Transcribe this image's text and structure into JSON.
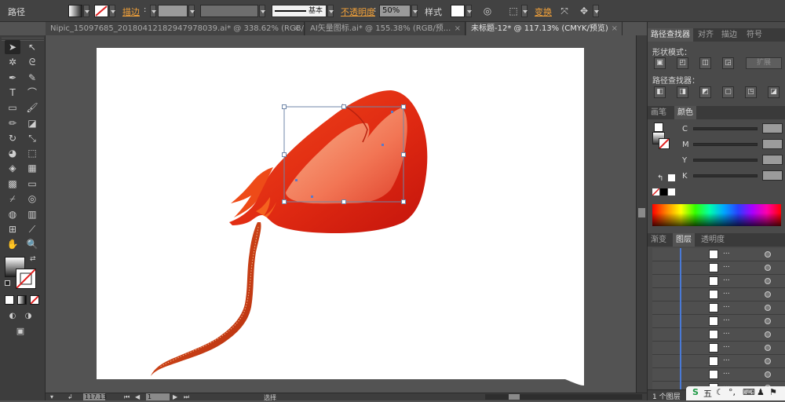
{
  "control_bar": {
    "path_label": "路径",
    "stroke_label": "描边",
    "stroke_profile": "基本",
    "opacity_label": "不透明度",
    "opacity_value": "50%",
    "style_label": "样式",
    "transform_label": "变换"
  },
  "tabs": [
    {
      "label": "Nipic_15097685_20180412182947978039.ai* @ 338.62% (RGB/预...",
      "close": "×"
    },
    {
      "label": "AI矢量图标.ai* @ 155.38% (RGB/预...",
      "close": "×"
    },
    {
      "label": "未标题-12* @ 117.13% (CMYK/预览)",
      "close": "×"
    }
  ],
  "panels": {
    "pathfinder_tabs": [
      "路径查找器",
      "对齐",
      "描边",
      "符号"
    ],
    "shape_modes_label": "形状模式：",
    "expand_label": "扩展",
    "pathfinder_label": "路径查找器：",
    "color_tabs": [
      "画笔",
      "颜色"
    ],
    "color_channels": [
      "C",
      "M",
      "Y",
      "K"
    ],
    "layer_tabs": [
      "渐变",
      "图层",
      "透明度"
    ],
    "layer_dots": "...",
    "layer_count": "1 个图层"
  },
  "status": {
    "zoom": "117.13",
    "page": "1",
    "mode": "选择"
  },
  "taskbar": {
    "ime_label": "五"
  },
  "colors": {
    "accent_orange": "#f3a23a",
    "fill_red": "#e63312",
    "layer_blue": "#4a7ad6"
  },
  "layer_row_count": 11
}
